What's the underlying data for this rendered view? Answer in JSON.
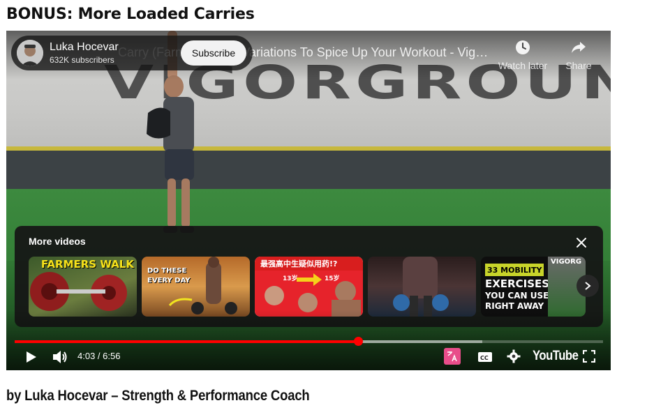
{
  "page": {
    "heading": "BONUS: More Loaded Carries",
    "byline": "by Luka Hocevar – Strength & Performance Coach"
  },
  "player": {
    "video_title": "Carry (Farmers Walk) Variations To Spice Up Your Workout - Vigo…",
    "wall_text": "VIGORGROUND",
    "channel": {
      "name": "Luka Hocevar",
      "subscribers": "632K subscribers",
      "subscribe_label": "Subscribe"
    },
    "actions": {
      "watch_later_label": "Watch later",
      "share_label": "Share"
    },
    "more_videos": {
      "title": "More videos",
      "thumbnails": [
        {
          "text": "FARMERS WALK",
          "icon": "farmers-walk-thumbnail"
        },
        {
          "text": "DO THESE EVERY DAY",
          "icon": "do-these-every-day-thumbnail"
        },
        {
          "text": "最强高中生疑似用药!?",
          "sub_left": "13岁",
          "sub_right": "15岁",
          "icon": "chinese-title-thumbnail"
        },
        {
          "text": "",
          "icon": "kettlebell-thumbnail"
        },
        {
          "text": "33 MOBILITY",
          "line2": "EXERCISES",
          "line3": "YOU CAN USE",
          "line4": "RIGHT AWAY",
          "corner": "VIGORG",
          "icon": "mobility-thumbnail"
        }
      ]
    },
    "progress": {
      "played_fraction": 0.584,
      "buffered_fraction": 0.795
    },
    "time": {
      "current": "4:03",
      "total": "6:56",
      "display": "4:03 / 6:56"
    },
    "logo": "YouTube",
    "colors": {
      "progress_red": "#ff0000",
      "player_bg": "#3a3d3b",
      "translate_badge": "#e84d8a"
    }
  }
}
